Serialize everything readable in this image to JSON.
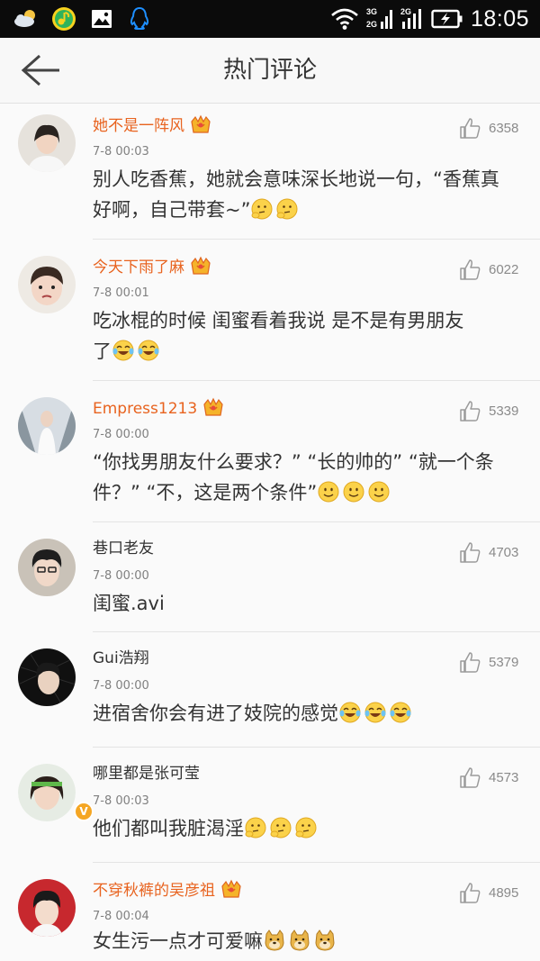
{
  "status_bar": {
    "time": "18:05",
    "net_top": "3G",
    "net_bottom": "2G",
    "net2": "2G"
  },
  "header": {
    "title": "热门评论"
  },
  "comments": [
    {
      "name": "她不是一阵风",
      "time": "7-8 00:03",
      "likes": "6358",
      "line1": "别人吃香蕉，她就会意味深长地说一句，“香蕉真",
      "line2": "好啊，自己带套~”",
      "emoji": "thinking",
      "emoji_count": 2,
      "vip": true
    },
    {
      "name": "今天下雨了麻",
      "time": "7-8 00:01",
      "likes": "6022",
      "line1": "吃冰棍的时候 闺蜜看着我说 是不是有男朋友",
      "line2": "了",
      "emoji": "laugh-cry",
      "emoji_count": 2,
      "vip": true
    },
    {
      "name": "Empress1213",
      "time": "7-8 00:00",
      "likes": "5339",
      "line1": "“你找男朋友什么要求？” “长的帅的” “就一个条",
      "line2": "件？” “不，这是两个条件”",
      "emoji": "smile",
      "emoji_count": 3,
      "vip": true
    },
    {
      "name": "巷口老友",
      "time": "7-8 00:00",
      "likes": "4703",
      "line1": "闺蜜.avi",
      "line2": "",
      "emoji": "",
      "emoji_count": 0,
      "vip": false
    },
    {
      "name": "Gui浩翔",
      "time": "7-8 00:00",
      "likes": "5379",
      "line1": "进宿舍你会有进了妓院的感觉",
      "line2": "",
      "emoji": "laugh-cry",
      "emoji_count": 3,
      "vip": false
    },
    {
      "name": "哪里都是张可莹",
      "time": "7-8 00:03",
      "likes": "4573",
      "line1": "他们都叫我脏渴淫",
      "line2": "",
      "emoji": "thinking",
      "emoji_count": 3,
      "vip": false
    },
    {
      "name": "不穿秋裤的吴彦祖",
      "time": "7-8 00:04",
      "likes": "4895",
      "line1": "女生污一点才可爱嘛",
      "line2": "",
      "emoji": "doge",
      "emoji_count": 3,
      "vip": true
    }
  ],
  "colors": {
    "vip_name": "#e8631f",
    "plain_name": "#333333",
    "meta": "#808080",
    "background": "#fafafa"
  }
}
